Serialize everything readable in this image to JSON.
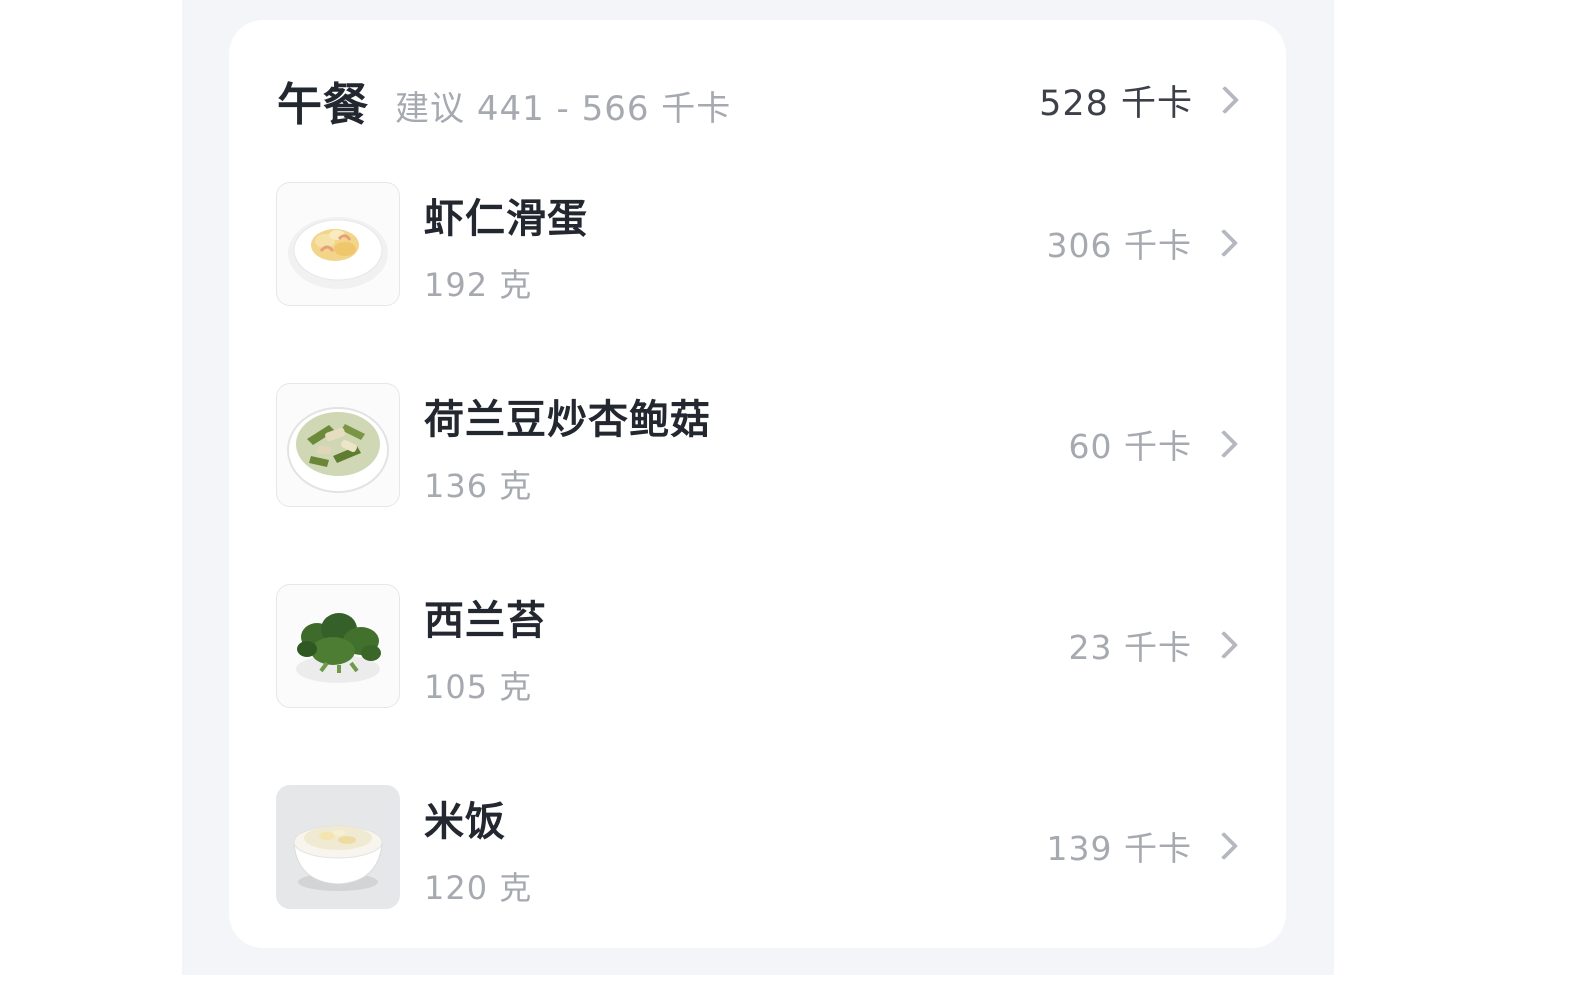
{
  "meal": {
    "title": "午餐",
    "hint": "建议 441 - 566 千卡",
    "total": "528 千卡"
  },
  "foods": [
    {
      "name": "虾仁滑蛋",
      "weight": "192 克",
      "kcal": "306 千卡",
      "image_icon": "shrimp-egg-plate-icon"
    },
    {
      "name": "荷兰豆炒杏鲍菇",
      "weight": "136 克",
      "kcal": "60 千卡",
      "image_icon": "snowpea-mushroom-bowl-icon"
    },
    {
      "name": "西兰苔",
      "weight": "105 克",
      "kcal": "23 千卡",
      "image_icon": "broccolini-plate-icon"
    },
    {
      "name": "米饭",
      "weight": "120 克",
      "kcal": "139 千卡",
      "image_icon": "rice-bowl-icon"
    }
  ],
  "colors": {
    "page_background": "#f4f5f9",
    "card_background": "#ffffff",
    "title_text": "#23272f",
    "secondary_text": "#a6a9b0",
    "chevron": "#b5b8be"
  }
}
